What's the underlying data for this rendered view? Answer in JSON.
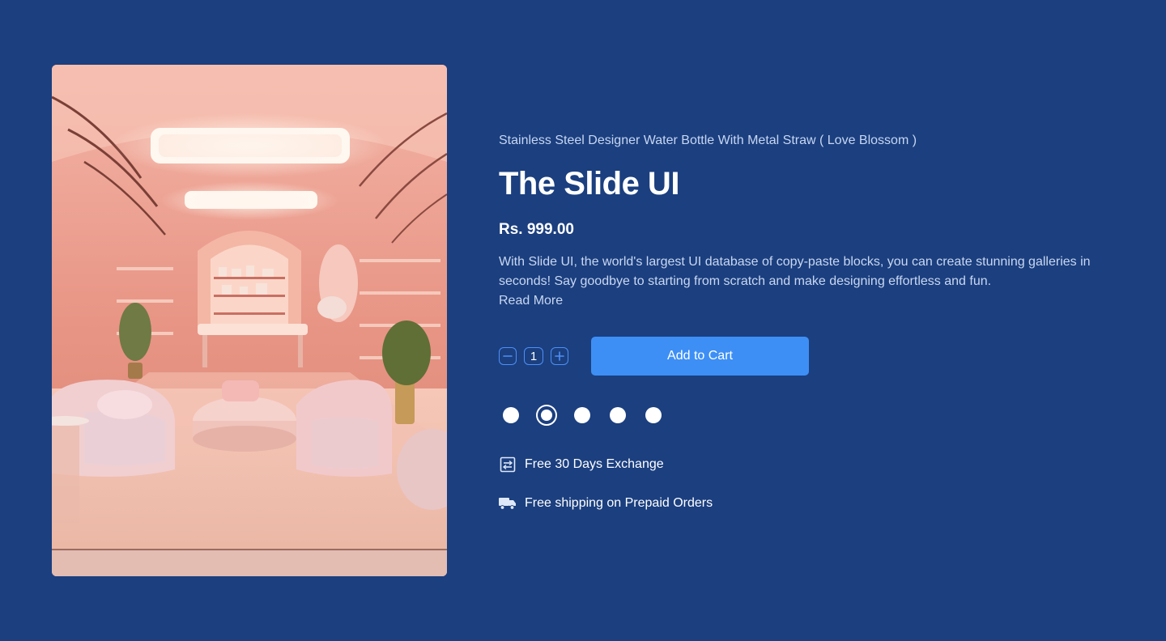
{
  "product": {
    "subtitle": "Stainless Steel Designer Water Bottle With Metal Straw ( Love Blossom )",
    "title": "The Slide UI",
    "price": "Rs. 999.00",
    "description": "With Slide UI, the world's largest UI database of copy-paste blocks, you can create stunning galleries in seconds! Say goodbye to starting from scratch and make designing effortless and fun.",
    "read_more": "Read More"
  },
  "cart": {
    "quantity": "1",
    "add_label": "Add to Cart"
  },
  "swatches": {
    "count": 5,
    "selected_index": 1
  },
  "features": [
    {
      "icon": "exchange-icon",
      "label": "Free 30 Days Exchange"
    },
    {
      "icon": "truck-icon",
      "label": "Free shipping on Prepaid Orders"
    }
  ],
  "colors": {
    "background": "#1b3f7f",
    "accent": "#3d8ff5",
    "outline": "#4f8ff7"
  }
}
